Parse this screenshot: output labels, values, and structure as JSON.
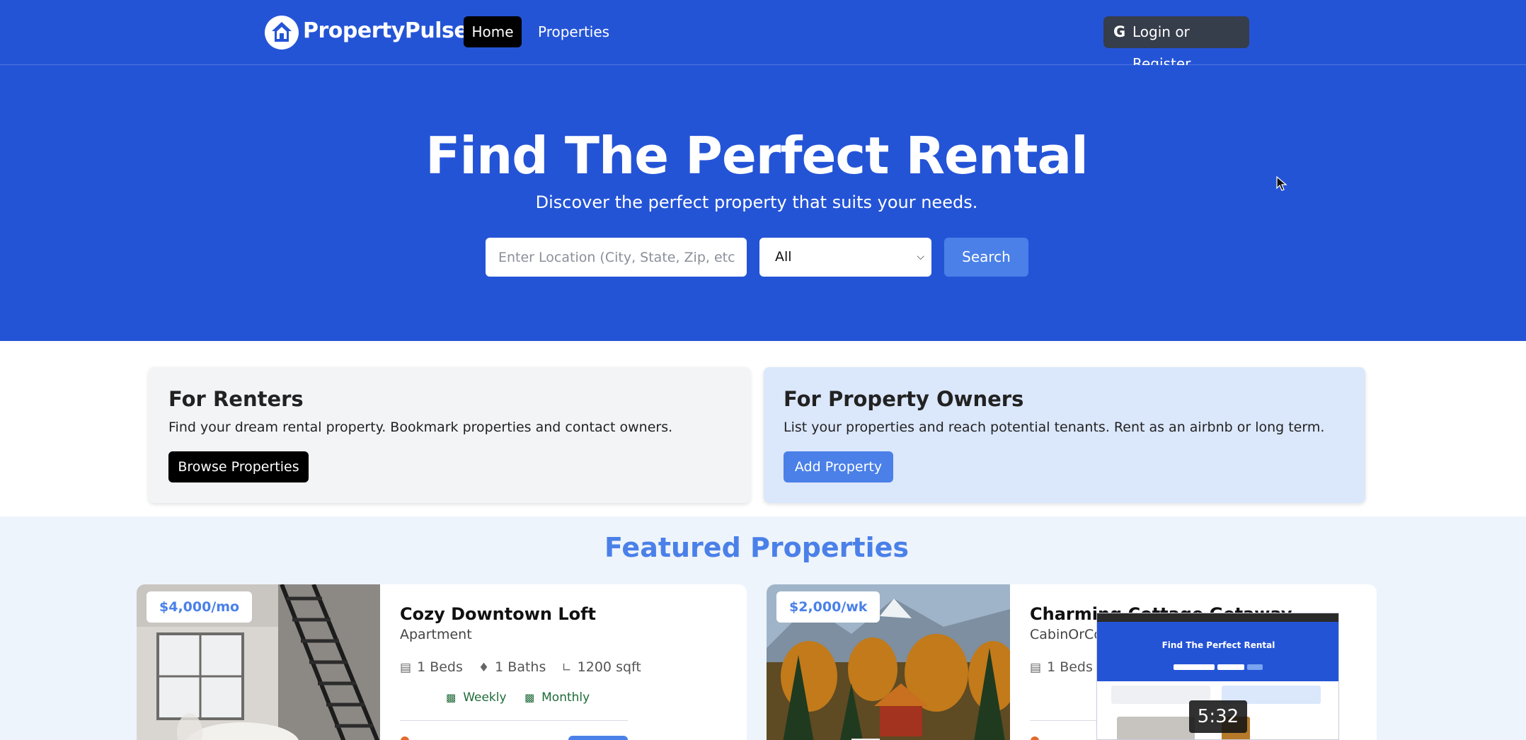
{
  "nav": {
    "brand": "PropertyPulse",
    "links": [
      {
        "label": "Home",
        "active": true
      },
      {
        "label": "Properties",
        "active": false
      }
    ],
    "login_label": "Login or Register",
    "login_icon": "G",
    "colors": {
      "bar": "#2454d6",
      "active_link": "#000000",
      "login_bg": "#363d4b"
    }
  },
  "hero": {
    "title": "Find The Perfect Rental",
    "subtitle": "Discover the perfect property that suits your needs.",
    "location_placeholder": "Enter Location (City, State, Zip, etc",
    "type_selected": "All",
    "search_label": "Search"
  },
  "info_cards": {
    "renters": {
      "title": "For Renters",
      "text": "Find your dream rental property. Bookmark properties and contact owners.",
      "button": "Browse Properties"
    },
    "owners": {
      "title": "For Property Owners",
      "text": "List your properties and reach potential tenants. Rent as an airbnb or long term.",
      "button": "Add Property"
    }
  },
  "featured": {
    "title": "Featured Properties",
    "properties": [
      {
        "price": "$4,000/mo",
        "name": "Cozy Downtown Loft",
        "type": "Apartment",
        "beds": "1 Beds",
        "baths": "1 Baths",
        "sqft": "1200 sqft",
        "rates": [
          "Weekly",
          "Monthly"
        ]
      },
      {
        "price": "$2,000/wk",
        "name": "Charming Cottage Getaway",
        "type": "CabinOrCo",
        "beds": "1 Beds"
      }
    ]
  },
  "video_overlay": {
    "duration": "5:32",
    "thumb_title": "Find The Perfect Rental"
  }
}
